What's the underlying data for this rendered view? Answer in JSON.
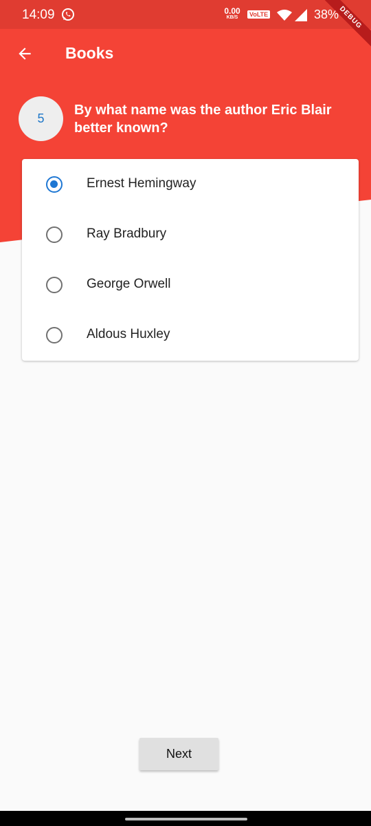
{
  "status_bar": {
    "time": "14:09",
    "net_speed_value": "0.00",
    "net_speed_unit": "KB/S",
    "volte": "VoLTE",
    "battery": "38%",
    "icons": [
      "whatsapp-icon",
      "wifi-icon",
      "signal-icon"
    ]
  },
  "app_bar": {
    "title": "Books",
    "back_icon": "arrow-left-icon",
    "debug_banner": "DEBUG"
  },
  "question": {
    "number": "5",
    "text": "By what name was the author Eric Blair better known?"
  },
  "options": [
    {
      "label": "Ernest Hemingway",
      "selected": true
    },
    {
      "label": "Ray Bradbury",
      "selected": false
    },
    {
      "label": "George Orwell",
      "selected": false
    },
    {
      "label": "Aldous Huxley",
      "selected": false
    }
  ],
  "footer": {
    "next_label": "Next"
  },
  "colors": {
    "primary": "#f44336",
    "status_bar": "#e03c31",
    "accent": "#1e77d3"
  }
}
